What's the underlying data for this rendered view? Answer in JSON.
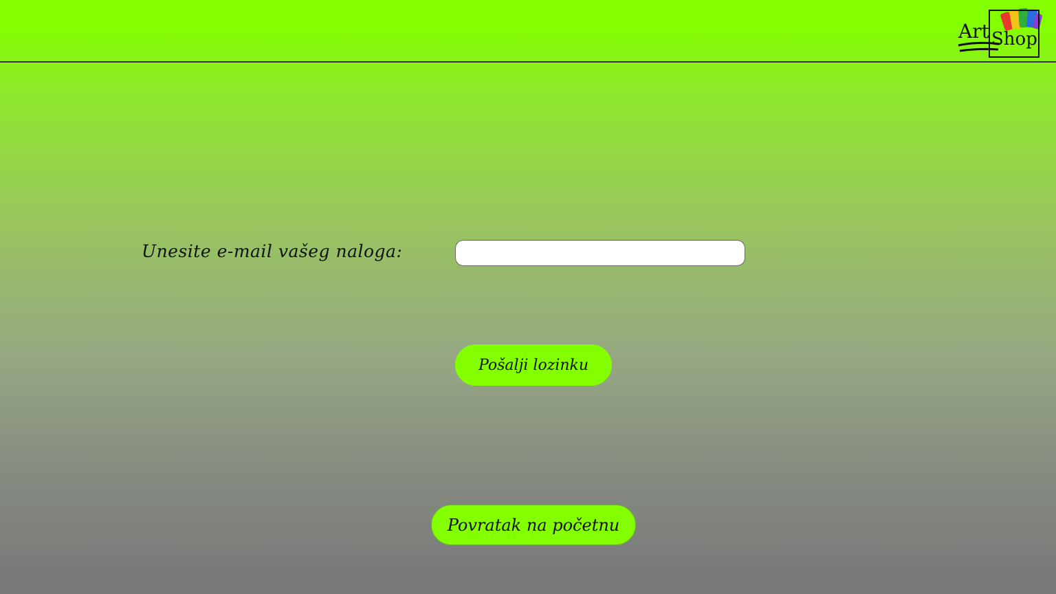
{
  "header": {
    "logo": {
      "word1": "Art",
      "word2": "Shop",
      "icon": "paint-brushes-icon"
    }
  },
  "form": {
    "email_label": "Unesite e-mail vašeg naloga:",
    "email_value": "",
    "email_placeholder": "",
    "send_button_label": "Pošalji lozinku"
  },
  "footer": {
    "back_button_label": "Povratak na početnu"
  },
  "colors": {
    "accent": "#84ff00",
    "background_top": "#84ff00",
    "background_bottom": "#777777"
  }
}
